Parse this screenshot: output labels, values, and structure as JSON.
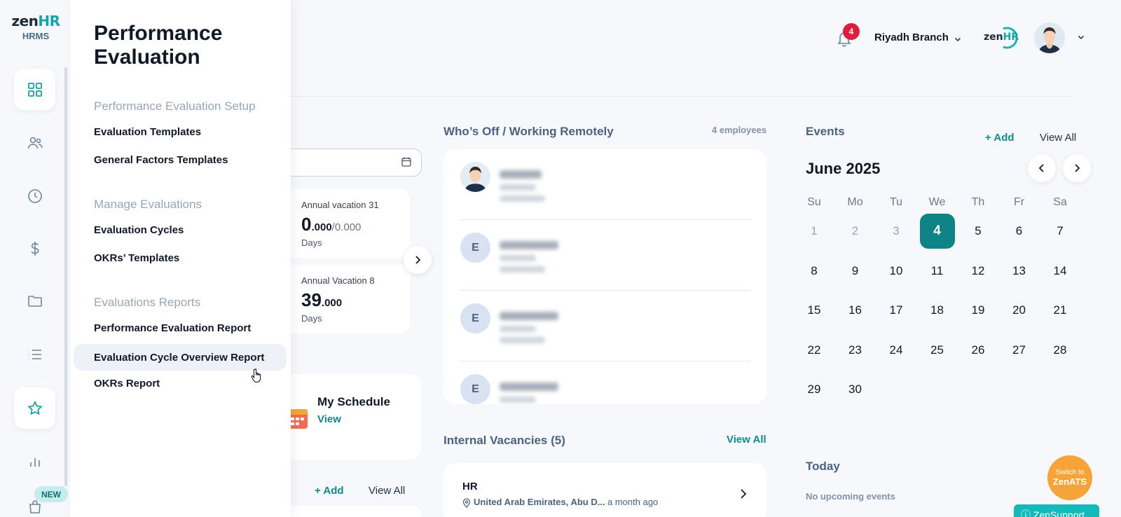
{
  "brand": {
    "logo_zen": "zen",
    "logo_hr": "HR",
    "subtitle": "HRMS"
  },
  "rail": {
    "items": [
      {
        "icon": "dashboard-icon",
        "active": true
      },
      {
        "icon": "people-icon",
        "active": false
      },
      {
        "icon": "clock-icon",
        "active": false
      },
      {
        "icon": "dollar-icon",
        "active": false
      },
      {
        "icon": "folder-icon",
        "active": false
      },
      {
        "icon": "list-icon",
        "active": false
      },
      {
        "icon": "star-icon",
        "active": true
      },
      {
        "icon": "bar-chart-icon",
        "active": false
      },
      {
        "icon": "bag-icon",
        "active": false
      }
    ],
    "new_badge": "NEW"
  },
  "flyout": {
    "title": "Performance Evaluation",
    "sections": [
      {
        "label": "Performance Evaluation Setup",
        "items": [
          "Evaluation Templates",
          "General Factors Templates"
        ]
      },
      {
        "label": "Manage Evaluations",
        "items": [
          "Evaluation Cycles",
          "OKRs’ Templates"
        ]
      },
      {
        "label": "Evaluations Reports",
        "items": [
          "Performance Evaluation Report",
          "Evaluation Cycle Overview Report",
          "OKRs Report"
        ]
      }
    ],
    "hovered_item": "Evaluation Cycle Overview Report"
  },
  "header": {
    "notifications_count": "4",
    "branch": "Riyadh Branch",
    "company_logo_zen": "zen",
    "company_logo_hr": "HR"
  },
  "balances": [
    {
      "title": "Annual vacation 31",
      "value_int": "0",
      "value_dec": ".000",
      "total": "/0.000",
      "unit": "Days"
    },
    {
      "title": "Annual Vacation 8",
      "value_int": "39",
      "value_dec": ".000",
      "total": "",
      "unit": "Days"
    }
  ],
  "schedule": {
    "title": "My Schedule",
    "link": "View"
  },
  "left_bottom": {
    "add": "+ Add",
    "view_all": "View All"
  },
  "whos_off": {
    "title": "Who’s Off / Working Remotely",
    "count": "4 employees",
    "rows": [
      {
        "avatar_type": "photo",
        "initial": ""
      },
      {
        "avatar_type": "initial",
        "initial": "E"
      },
      {
        "avatar_type": "initial",
        "initial": "E"
      },
      {
        "avatar_type": "initial",
        "initial": "E"
      }
    ]
  },
  "vacancies": {
    "title": "Internal Vacancies (5)",
    "view_all": "View All",
    "items": [
      {
        "title": "HR",
        "location": "United Arab Emirates, Abu D...",
        "posted": "a month ago"
      }
    ]
  },
  "events": {
    "title": "Events",
    "add": "+ Add",
    "view_all": "View All",
    "month": "June 2025",
    "weekdays": [
      "Su",
      "Mo",
      "Tu",
      "We",
      "Th",
      "Fr",
      "Sa"
    ],
    "days": [
      "1",
      "2",
      "3",
      "4",
      "5",
      "6",
      "7",
      "8",
      "9",
      "10",
      "11",
      "12",
      "13",
      "14",
      "15",
      "16",
      "17",
      "18",
      "19",
      "20",
      "21",
      "22",
      "23",
      "24",
      "25",
      "26",
      "27",
      "28",
      "29",
      "30"
    ],
    "muted_days": [
      "1",
      "2",
      "3"
    ],
    "today": "4",
    "today_title": "Today",
    "no_events": "No upcoming events"
  },
  "ats": {
    "line1": "Switch to",
    "line2": "ZenATS"
  },
  "support": {
    "label": "ZenSupport"
  }
}
